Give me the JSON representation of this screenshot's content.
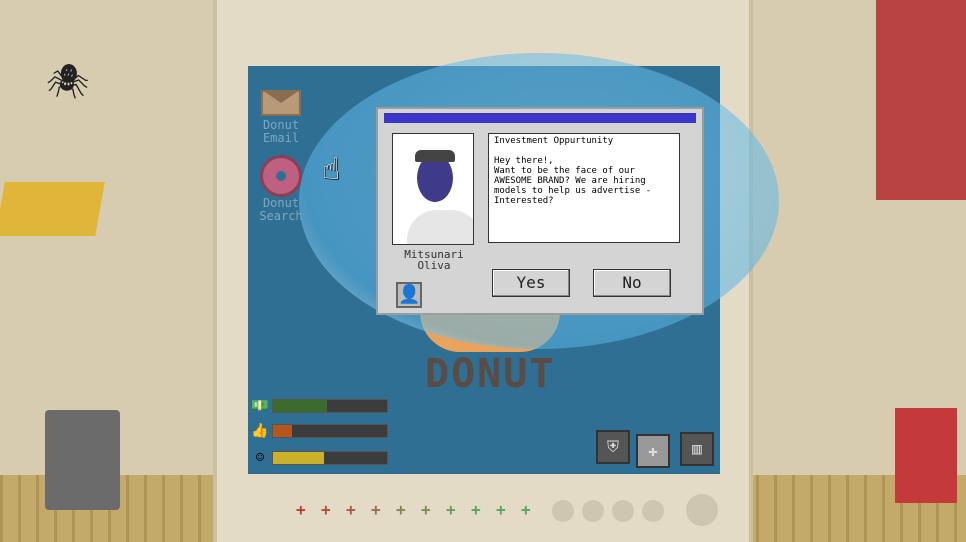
{
  "desktop": {
    "icons": [
      {
        "label": "Donut Email"
      },
      {
        "label": "Donut Search"
      }
    ],
    "logo_text": "DONUT"
  },
  "dialog": {
    "character_name": "Mitsunari Oliva",
    "message": "Investment Oppurtunity\n\nHey there!,\nWant to be the face of our AWESOME BRAND? We are hiring models to help us advertise - Interested?",
    "yes_label": "Yes",
    "no_label": "No"
  },
  "stats": [
    {
      "name": "money-icon",
      "fill": 0.47,
      "color": "#3d6b2e"
    },
    {
      "name": "fame-icon",
      "fill": 0.17,
      "color": "#b5561e"
    },
    {
      "name": "happiness-icon",
      "fill": 0.45,
      "color": "#c9b12c"
    }
  ],
  "screen_icons": [
    "shield-icon",
    "first-aid-icon",
    "stats-icon"
  ],
  "bottom_row": {
    "plus_count": 10,
    "dot_count": 6
  }
}
